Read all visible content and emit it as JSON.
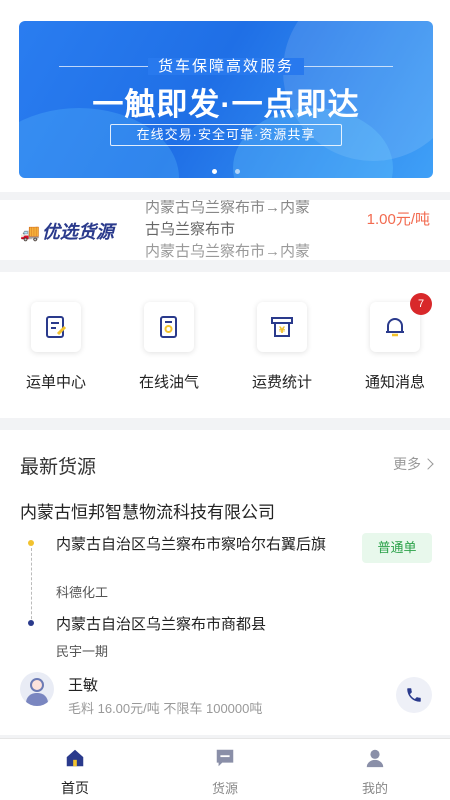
{
  "banner": {
    "subtitle": "货车保障高效服务",
    "headline": "一触即发·一点即达",
    "tagline": "在线交易·安全可靠·资源共享"
  },
  "ticker": {
    "logo_text": "优选货源",
    "route_top": "内蒙古乌兰察布市→内蒙",
    "route_mid": "古乌兰察布市",
    "route_bot": "内蒙古乌兰察布市→内蒙",
    "price": "1.00元/吨"
  },
  "grid": {
    "items": [
      {
        "label": "运单中心",
        "icon": "waybill-icon"
      },
      {
        "label": "在线油气",
        "icon": "fuel-icon"
      },
      {
        "label": "运费统计",
        "icon": "freight-stats-icon"
      },
      {
        "label": "通知消息",
        "icon": "bell-icon",
        "badge": "7"
      }
    ]
  },
  "latest": {
    "title": "最新货源",
    "more": "更多",
    "company": "内蒙古恒邦智慧物流科技有限公司",
    "origin": "内蒙古自治区乌兰察布市察哈尔右翼后旗",
    "origin_company": "科德化工",
    "order_type": "普通单",
    "destination": "内蒙古自治区乌兰察布市商都县",
    "destination_company": "民宇一期",
    "contact_name": "王敏",
    "contact_meta": "毛料 16.00元/吨 不限车 100000吨"
  },
  "tabbar": {
    "items": [
      {
        "label": "首页",
        "icon": "home-icon",
        "active": true
      },
      {
        "label": "货源",
        "icon": "cargo-icon",
        "active": false
      },
      {
        "label": "我的",
        "icon": "profile-icon",
        "active": false
      }
    ]
  },
  "colors": {
    "brand_navy": "#2a3a8c",
    "banner_blue": "#1f6fe6",
    "price_orange": "#f26a4f",
    "badge_red": "#d8282a",
    "order_green": "#2ca24a"
  }
}
